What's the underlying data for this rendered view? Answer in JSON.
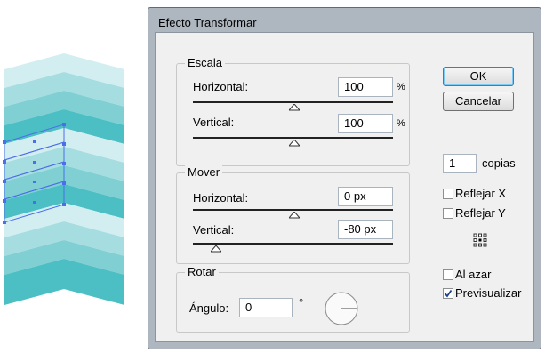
{
  "window": {
    "title": "Efecto Transformar"
  },
  "scale": {
    "legend": "Escala",
    "horizontal_label": "Horizontal:",
    "horizontal_value": "100",
    "horizontal_unit": "%",
    "vertical_label": "Vertical:",
    "vertical_value": "100",
    "vertical_unit": "%"
  },
  "move": {
    "legend": "Mover",
    "horizontal_label": "Horizontal:",
    "horizontal_value": "0 px",
    "vertical_label": "Vertical:",
    "vertical_value": "-80 px"
  },
  "rotate": {
    "legend": "Rotar",
    "angle_label": "Ángulo:",
    "angle_value": "0",
    "angle_unit": "°"
  },
  "buttons": {
    "ok": "OK",
    "cancel": "Cancelar"
  },
  "copies": {
    "value": "1",
    "label": "copias"
  },
  "options": {
    "reflect_x": {
      "label": "Reflejar X",
      "checked": false
    },
    "reflect_y": {
      "label": "Reflejar Y",
      "checked": false
    },
    "random": {
      "label": "Al azar",
      "checked": false
    },
    "preview": {
      "label": "Previsualizar",
      "checked": true
    }
  },
  "colors": {
    "band_light": "#d3eef0",
    "band_mid": "#a6dde0",
    "band_dark": "#7fcfd3",
    "band_darkest": "#4bbfc3",
    "selection": "#4a6fe8"
  }
}
